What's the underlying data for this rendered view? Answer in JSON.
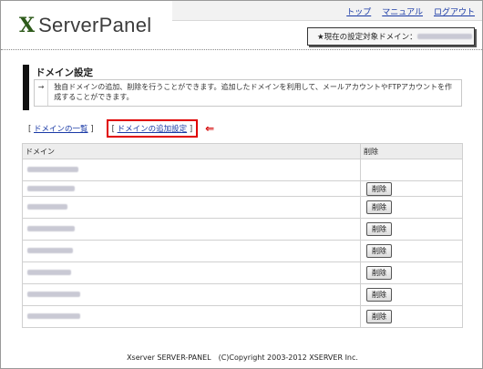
{
  "header": {
    "logo_mark": "X",
    "logo_text": "ServerPanel",
    "nav": [
      "トップ",
      "マニュアル",
      "ログアウト"
    ],
    "target_label": "★現在の設定対象ドメイン："
  },
  "page": {
    "title": "ドメイン設定",
    "desc_arrow": "→",
    "desc_text": "独自ドメインの追加、削除を行うことができます。追加したドメインを利用して、メールアカウントやFTPアカウントを作成することができます。"
  },
  "tabs": {
    "open": "[",
    "close": "]",
    "list_label": "ドメインの一覧",
    "add_label": "ドメインの追加設定",
    "indicator": "⇐"
  },
  "table": {
    "headers": [
      "ドメイン",
      "削除"
    ],
    "delete_label": "削除",
    "rows": [
      {
        "has_delete": false
      },
      {
        "has_delete": true
      },
      {
        "has_delete": true
      },
      {
        "has_delete": true
      },
      {
        "has_delete": true
      },
      {
        "has_delete": true
      },
      {
        "has_delete": true
      },
      {
        "has_delete": true
      }
    ]
  },
  "footer": "Xserver SERVER-PANEL　(C)Copyright 2003-2012 XSERVER Inc."
}
